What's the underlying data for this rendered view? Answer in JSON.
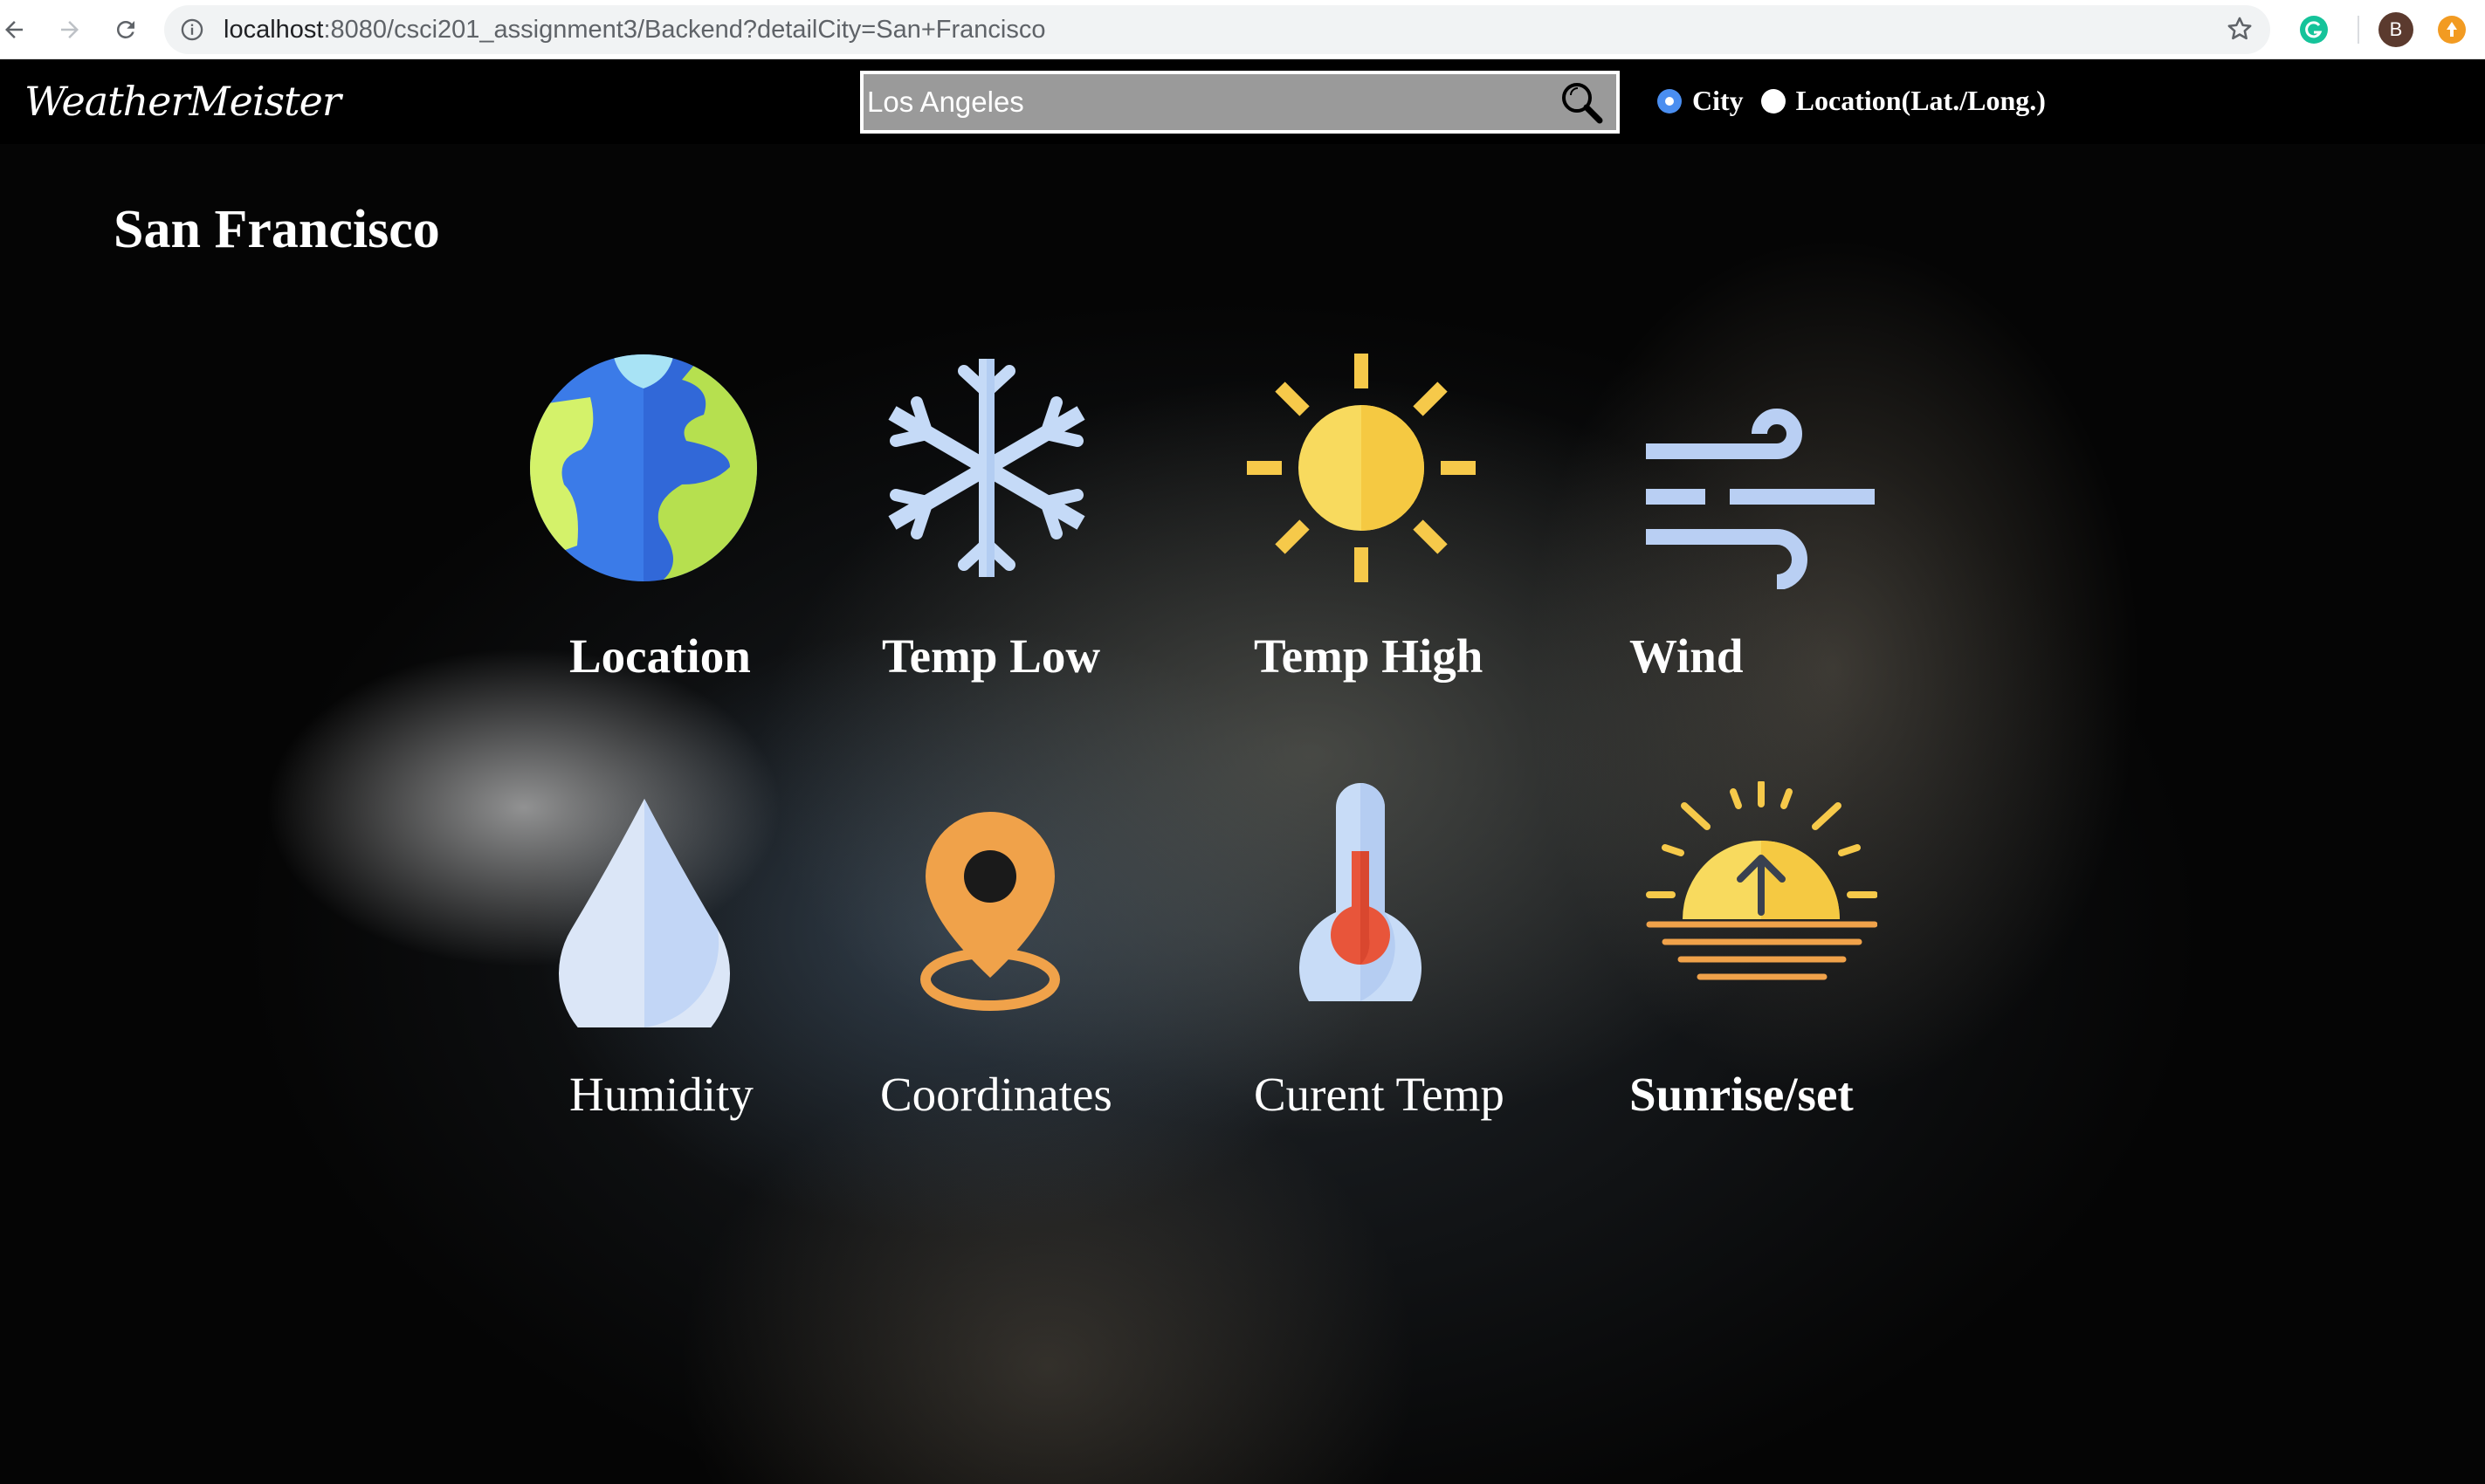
{
  "browser": {
    "url_host": "localhost",
    "url_path": ":8080/csci201_assignment3/Backend?detailCity=San+Francisco",
    "profile_initial": "B",
    "icons": [
      "back-arrow-icon",
      "forward-arrow-icon",
      "reload-icon",
      "info-icon",
      "star-icon",
      "grammarly-icon",
      "extension-icon"
    ]
  },
  "header": {
    "logo": "WeatherMeister",
    "search_value": "Los Angeles",
    "radio_options": [
      {
        "label": "City",
        "checked": true
      },
      {
        "label": "Location(Lat./Long.)",
        "checked": false
      }
    ]
  },
  "main": {
    "city": "San Francisco",
    "tiles": [
      {
        "label": "Location",
        "icon": "globe-icon"
      },
      {
        "label": "Temp Low",
        "icon": "snowflake-icon"
      },
      {
        "label": "Temp High",
        "icon": "sun-icon"
      },
      {
        "label": "Wind",
        "icon": "wind-icon"
      },
      {
        "label": "Humidity",
        "icon": "water-drop-icon"
      },
      {
        "label": "Coordinates",
        "icon": "map-pin-icon"
      },
      {
        "label": "Curent Temp",
        "icon": "thermometer-icon"
      },
      {
        "label": "Sunrise/set",
        "icon": "sunrise-icon"
      }
    ]
  },
  "colors": {
    "header_bg": "#000000",
    "search_bg": "#9a9a9a",
    "radio_checked": "#4a8ef0",
    "globe_blue": "#3b7be8",
    "globe_green": "#b6e04f",
    "sun_yellow": "#f6c94a",
    "ice_blue": "#c5daf7",
    "pin_orange": "#f0a24a",
    "thermo_red": "#e8553a"
  }
}
